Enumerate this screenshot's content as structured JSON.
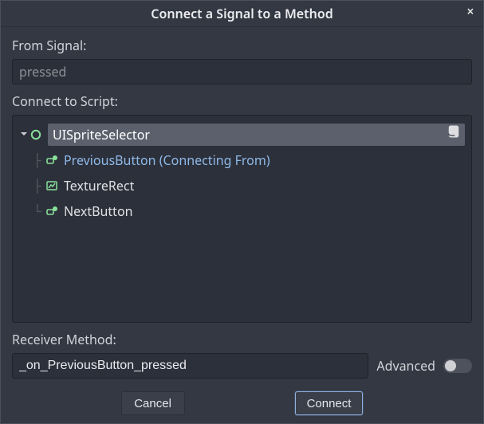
{
  "title": "Connect a Signal to a Method",
  "from_signal_label": "From Signal:",
  "from_signal_value": "pressed",
  "connect_script_label": "Connect to Script:",
  "tree": {
    "root": {
      "name": "UISpriteSelector",
      "icon": "node-ring-icon",
      "has_script": true
    },
    "children": [
      {
        "name": "PreviousButton (Connecting From)",
        "icon": "button-icon",
        "connecting": true
      },
      {
        "name": "TextureRect",
        "icon": "image-rect-icon",
        "connecting": false
      },
      {
        "name": "NextButton",
        "icon": "button-icon",
        "connecting": false
      }
    ]
  },
  "receiver_method_label": "Receiver Method:",
  "receiver_method_value": "_on_PreviousButton_pressed",
  "advanced_label": "Advanced",
  "buttons": {
    "cancel": "Cancel",
    "connect": "Connect"
  }
}
